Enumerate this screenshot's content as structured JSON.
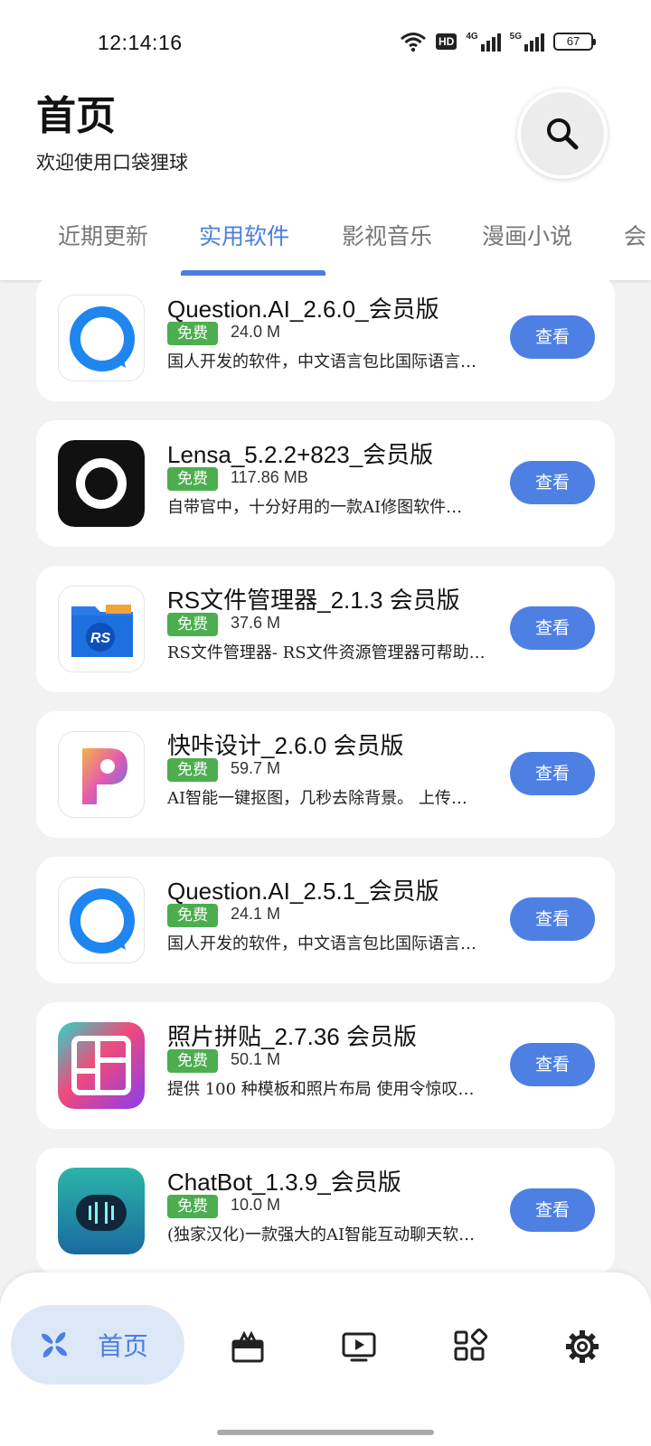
{
  "status": {
    "time": "12:14:16",
    "battery": "67",
    "hd": "HD",
    "sig1": "4G",
    "sig2": "5G"
  },
  "header": {
    "title": "首页",
    "subtitle": "欢迎使用口袋狸球"
  },
  "tabs": [
    {
      "label": "近期更新"
    },
    {
      "label": "实用软件",
      "active": true
    },
    {
      "label": "影视音乐"
    },
    {
      "label": "漫画小说"
    },
    {
      "label": "会"
    }
  ],
  "apps": [
    {
      "name": "Question.AI_2.6.0_会员版",
      "badge": "免费",
      "size": "24.0 M",
      "desc": "国人开发的软件，中文语言包比国际语言…",
      "button": "查看",
      "icon": "question-ai-icon"
    },
    {
      "name": "Lensa_5.2.2+823_会员版",
      "badge": "免费",
      "size": "117.86 MB",
      "desc": "自带官中，十分好用的一款AI修图软件…",
      "button": "查看",
      "icon": "lensa-icon"
    },
    {
      "name": "RS文件管理器_2.1.3 会员版",
      "badge": "免费",
      "size": "37.6 M",
      "desc": "RS文件管理器- RS文件资源管理器可帮助…",
      "button": "查看",
      "icon": "rs-file-manager-icon"
    },
    {
      "name": "快咔设计_2.6.0 会员版",
      "badge": "免费",
      "size": "59.7 M",
      "desc": "AI智能一键抠图，几秒去除背景。 上传…",
      "button": "查看",
      "icon": "kuaika-design-icon"
    },
    {
      "name": "Question.AI_2.5.1_会员版",
      "badge": "免费",
      "size": "24.1 M",
      "desc": "国人开发的软件，中文语言包比国际语言…",
      "button": "查看",
      "icon": "question-ai-icon"
    },
    {
      "name": "照片拼贴_2.7.36 会员版",
      "badge": "免费",
      "size": "50.1 M",
      "desc": "提供 100 种模板和照片布局 使用令惊叹…",
      "button": "查看",
      "icon": "photo-collage-icon"
    },
    {
      "name": "ChatBot_1.3.9_会员版",
      "badge": "免费",
      "size": "10.0 M",
      "desc": "(独家汉化)一款强大的AI智能互动聊天软…",
      "button": "查看",
      "icon": "chatbot-icon"
    }
  ],
  "nav": {
    "home_label": "首页",
    "items": [
      "home-icon",
      "gift-icon",
      "video-icon",
      "apps-icon",
      "settings-icon"
    ]
  },
  "colors": {
    "accent": "#4a7fe0",
    "badge": "#4cae4f",
    "button": "#4e80e4"
  }
}
